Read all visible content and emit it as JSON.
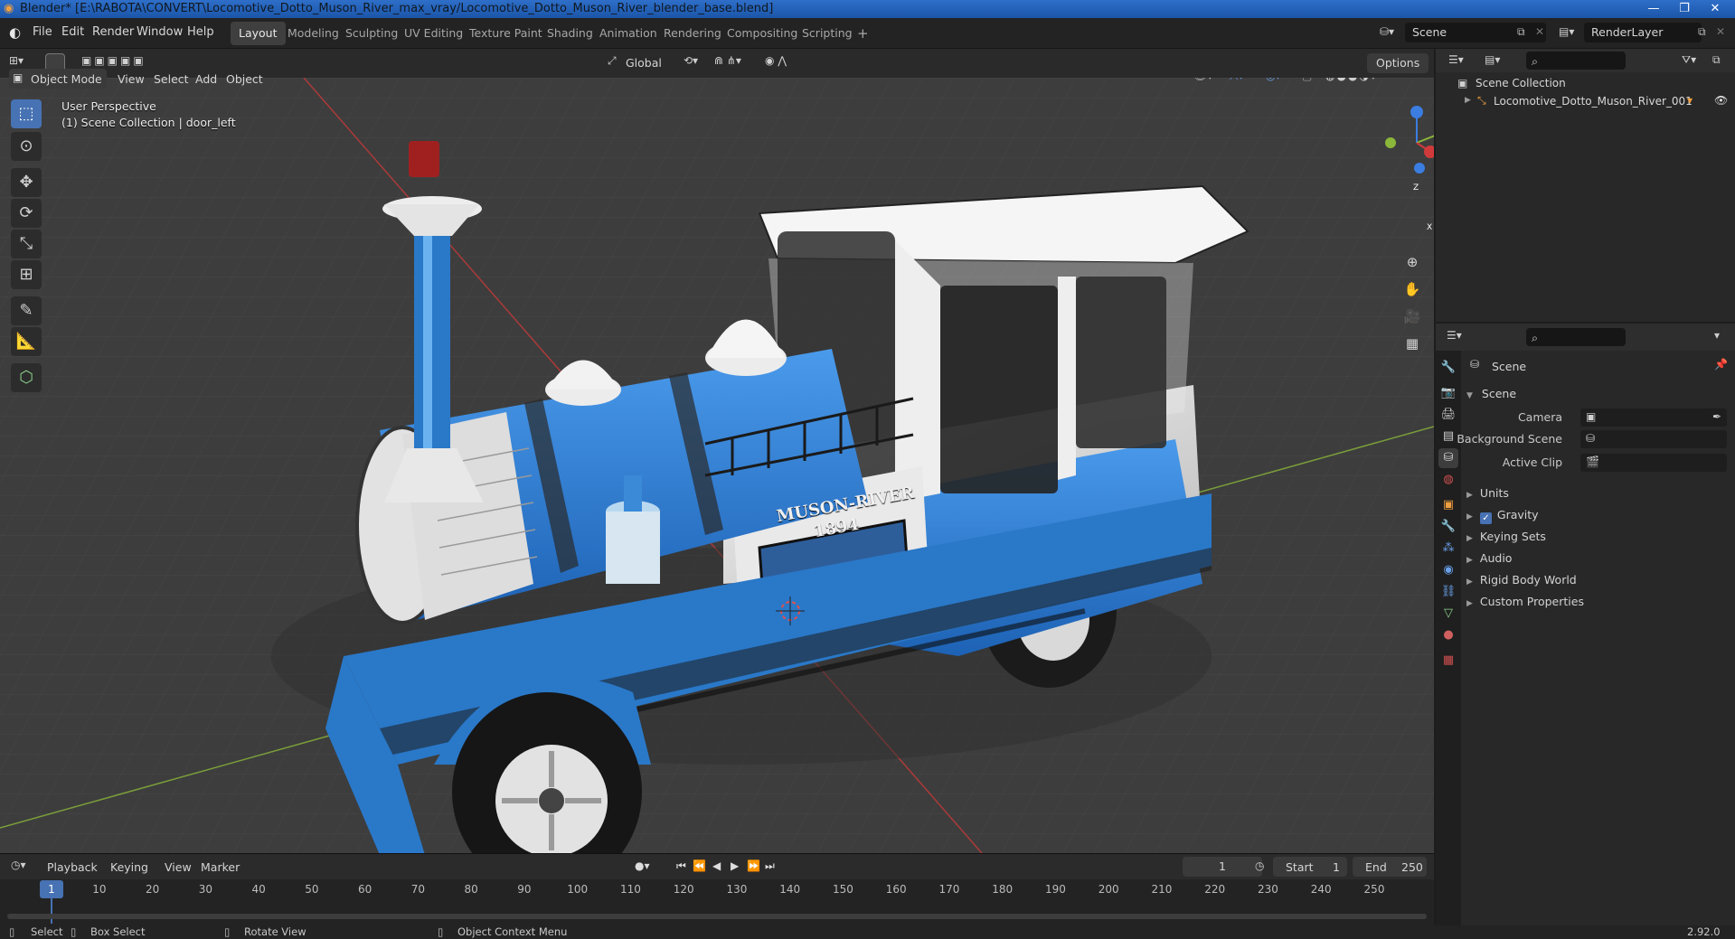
{
  "window": {
    "title": "Blender* [E:\\RABOTA\\CONVERT\\Locomotive_Dotto_Muson_River_max_vray/Locomotive_Dotto_Muson_River_blender_base.blend]"
  },
  "menu": {
    "items": [
      "File",
      "Edit",
      "Render",
      "Window",
      "Help"
    ],
    "workspaces": [
      "Layout",
      "Modeling",
      "Sculpting",
      "UV Editing",
      "Texture Paint",
      "Shading",
      "Animation",
      "Rendering",
      "Compositing",
      "Scripting"
    ],
    "active_workspace": "Layout",
    "add_tab": "+",
    "scene_name": "Scene",
    "view_layer": "RenderLayer"
  },
  "viewport_header": {
    "transform_orientation": "Global",
    "options_label": "Options",
    "mode": "Object Mode",
    "menus": [
      "View",
      "Select",
      "Add",
      "Object"
    ]
  },
  "viewport": {
    "perspective_label": "User Perspective",
    "context_label": "(1) Scene Collection | door_left",
    "model": {
      "plaque_line1": "MUSON-RIVER",
      "plaque_line2": "1894"
    },
    "gizmo": {
      "x": "X",
      "y": "Y",
      "z": "Z"
    }
  },
  "timeline": {
    "menus": [
      "Playback",
      "Keying",
      "View",
      "Marker"
    ],
    "current_frame": "1",
    "start_label": "Start",
    "start_value": "1",
    "end_label": "End",
    "end_value": "250",
    "ticks": [
      "1",
      "10",
      "20",
      "30",
      "40",
      "50",
      "60",
      "70",
      "80",
      "90",
      "100",
      "110",
      "120",
      "130",
      "140",
      "150",
      "160",
      "170",
      "180",
      "190",
      "200",
      "210",
      "220",
      "230",
      "240",
      "250"
    ]
  },
  "statusbar": {
    "select": "Select",
    "box_select": "Box Select",
    "rotate_view": "Rotate View",
    "context_menu": "Object Context Menu",
    "version": "2.92.0"
  },
  "outliner": {
    "root": "Scene Collection",
    "items": [
      "Locomotive_Dotto_Muson_River_001"
    ]
  },
  "properties": {
    "context_title": "Scene",
    "panel_title": "Scene",
    "fields": [
      {
        "label": "Camera",
        "value": ""
      },
      {
        "label": "Background Scene",
        "value": ""
      },
      {
        "label": "Active Clip",
        "value": ""
      }
    ],
    "subpanels": [
      "Units",
      "Gravity",
      "Keying Sets",
      "Audio",
      "Rigid Body World",
      "Custom Properties"
    ],
    "gravity_checked": true
  },
  "colors": {
    "accent": "#4772b3",
    "loco_blue": "#2a78c8",
    "loco_white": "#e6e6e6",
    "axis_x": "#d03a3a",
    "axis_y": "#8bb73a",
    "axis_z": "#3b7de0"
  }
}
